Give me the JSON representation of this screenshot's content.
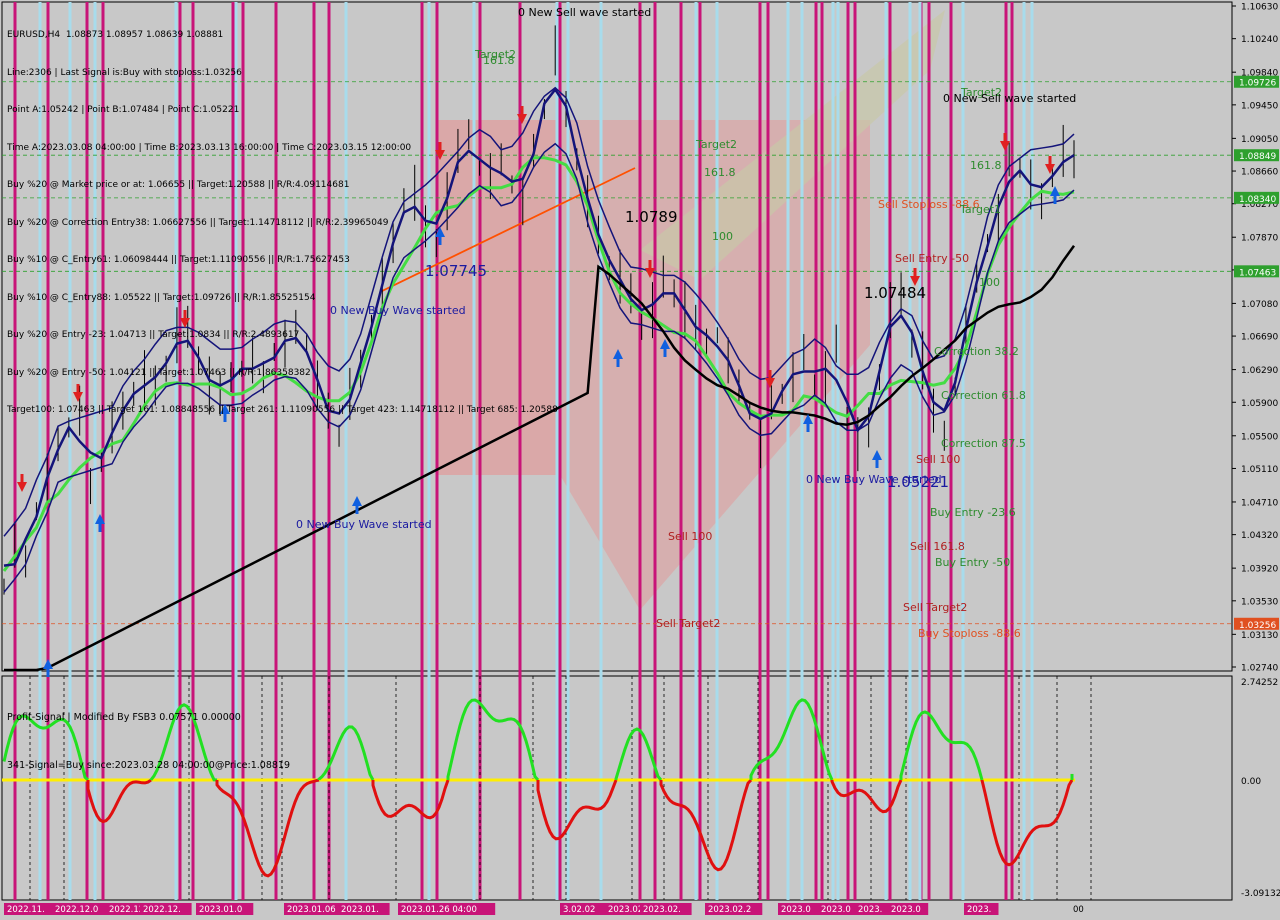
{
  "header": {
    "symbol_line": "EURUSD,H4  1.08873 1.08957 1.08639 1.08881",
    "lines": [
      "Line:2306 | Last Signal is:Buy with stoploss:1.03256",
      "Point A:1.05242 | Point B:1.07484 | Point C:1.05221",
      "Time A:2023.03.08 04:00:00 | Time B:2023.03.13 16:00:00 | Time C:2023.03.15 12:00:00",
      "Buy %20 @ Market price or at: 1.06655 || Target:1.20588 || R/R:4.09114681",
      "Buy %20 @ Correction Entry38: 1.06627556 || Target:1.14718112 || R/R:2.39965049",
      "Buy %10 @ C_Entry61: 1.06098444 || Target:1.11090556 || R/R:1.75627453",
      "Buy %10 @ C_Entry88: 1.05522 || Target:1.09726 || R/R:1.85525154",
      "Buy %20 @ Entry -23: 1.04713 || Target:1.0834 || R/R:2.4893617",
      "Buy %20 @ Entry -50: 1.04121 || Target:1.07463 || R/R:1.86358382",
      "Target100: 1.07463 || Target 161: 1.08848556 || Target 261: 1.11090556 || Target 423: 1.14718112 || Target 685: 1.20588"
    ]
  },
  "subwindow": {
    "title": "Profit-Signal | Modified By FSB3 0.07571 0.00000",
    "signal": "341-Signal=Buy since:2023.03.28 04:00:00@Price:1.08819"
  },
  "price_axis": {
    "ticks": [
      "1.10630",
      "1.10240",
      "1.09840",
      "1.09450",
      "1.09050",
      "1.08660",
      "1.08270",
      "1.07870",
      "1.07480",
      "1.07080",
      "1.06690",
      "1.06290",
      "1.05900",
      "1.05500",
      "1.05110",
      "1.04710",
      "1.04320",
      "1.03920",
      "1.03530",
      "1.03130",
      "1.02740"
    ],
    "markers": [
      {
        "value": "1.09726",
        "color": "#2ea02e"
      },
      {
        "value": "1.08849",
        "color": "#2ea02e"
      },
      {
        "value": "1.08340",
        "color": "#2ea02e"
      },
      {
        "value": "1.07463",
        "color": "#2ea02e"
      },
      {
        "value": "1.03256",
        "color": "#e05020"
      }
    ]
  },
  "sub_axis": {
    "top": "2.74252",
    "zero": "0.00",
    "bottom": "-3.09132"
  },
  "time_axis": [
    "2022.11.",
    "2022.12.0",
    "2022.12.",
    "2022.12.",
    "2023.01.0",
    "2023.01.06 08:00",
    "2023.01.",
    "2023.01.26 04:00",
    "3.02.02",
    "2023.02.",
    "2023.02.",
    "2023.02.2",
    "2023.0",
    "2023.0",
    "2023.",
    "2023.0",
    "2023.",
    "00"
  ],
  "chart_labels": [
    {
      "t": "0 New Sell wave started",
      "c": "#000"
    },
    {
      "t": "Target2",
      "c": "#2e8b2e"
    },
    {
      "t": "161.8",
      "c": "#2e8b2e"
    },
    {
      "t": "1.07745",
      "c": "#1a1aa0"
    },
    {
      "t": "0 New Buy Wave started",
      "c": "#1a1aa0"
    },
    {
      "t": "0 New Buy Wave started",
      "c": "#1a1aa0"
    },
    {
      "t": "1.0789",
      "c": "#000"
    },
    {
      "t": "Target2",
      "c": "#2e8b2e"
    },
    {
      "t": "161.8",
      "c": "#2e8b2e"
    },
    {
      "t": "100",
      "c": "#2e8b2e"
    },
    {
      "t": "Sell 100",
      "c": "#b02020"
    },
    {
      "t": "Sell Target2",
      "c": "#b02020"
    },
    {
      "t": "0 New Buy Wave started",
      "c": "#1a1aa0"
    },
    {
      "t": "1.05221",
      "c": "#1a1aa0"
    },
    {
      "t": "Sell Stoploss -88.6",
      "c": "#e05020"
    },
    {
      "t": "Sell Entry -50",
      "c": "#b02020"
    },
    {
      "t": "1.07484",
      "c": "#000"
    },
    {
      "t": "Sell 161.8",
      "c": "#b02020"
    },
    {
      "t": "Sell 100",
      "c": "#b02020"
    },
    {
      "t": "Buy Entry -23.6",
      "c": "#2e8b2e"
    },
    {
      "t": "Buy Entry -50",
      "c": "#2e8b2e"
    },
    {
      "t": "Sell Target2",
      "c": "#b02020"
    },
    {
      "t": "Buy Stoploss -88.6",
      "c": "#e05020"
    },
    {
      "t": "Target2",
      "c": "#2e8b2e"
    },
    {
      "t": "0 New Sell wave started",
      "c": "#000"
    },
    {
      "t": "161.8",
      "c": "#2e8b2e"
    },
    {
      "t": "Target1",
      "c": "#2e8b2e"
    },
    {
      "t": "100",
      "c": "#2e8b2e"
    },
    {
      "t": "Correction 38.2",
      "c": "#2e8b2e"
    },
    {
      "t": "Correction 61.8",
      "c": "#2e8b2e"
    },
    {
      "t": "Correction 87.5",
      "c": "#2e8b2e"
    }
  ],
  "chart_data": {
    "type": "candlestick",
    "symbol": "EURUSD",
    "timeframe": "H4",
    "ylim": [
      1.0274,
      1.1063
    ],
    "last_close": 1.08881,
    "levels": [
      1.09726,
      1.08849,
      1.0834,
      1.07463,
      1.03256
    ],
    "price_path": [
      1.037,
      1.042,
      1.04,
      1.046,
      1.05,
      1.054,
      1.056,
      1.058,
      1.049,
      1.052,
      1.056,
      1.058,
      1.06,
      1.062,
      1.061,
      1.063,
      1.067,
      1.068,
      1.064,
      1.061,
      1.06,
      1.062,
      1.063,
      1.064,
      1.062,
      1.065,
      1.066,
      1.068,
      1.066,
      1.061,
      1.058,
      1.055,
      1.06,
      1.063,
      1.068,
      1.073,
      1.078,
      1.083,
      1.084,
      1.08,
      1.078,
      1.083,
      1.089,
      1.091,
      1.087,
      1.086,
      1.088,
      1.085,
      1.083,
      1.089,
      1.094,
      1.101,
      1.094,
      1.088,
      1.083,
      1.079,
      1.075,
      1.074,
      1.072,
      1.068,
      1.07,
      1.074,
      1.072,
      1.07,
      1.068,
      1.066,
      1.067,
      1.064,
      1.061,
      1.058,
      1.054,
      1.059,
      1.06,
      1.062,
      1.065,
      1.061,
      1.062,
      1.066,
      1.057,
      1.054,
      1.056,
      1.062,
      1.07,
      1.072,
      1.066,
      1.064,
      1.058,
      1.055,
      1.061,
      1.068,
      1.074,
      1.078,
      1.081,
      1.088,
      1.087,
      1.085,
      1.083,
      1.086,
      1.089,
      1.088
    ]
  }
}
